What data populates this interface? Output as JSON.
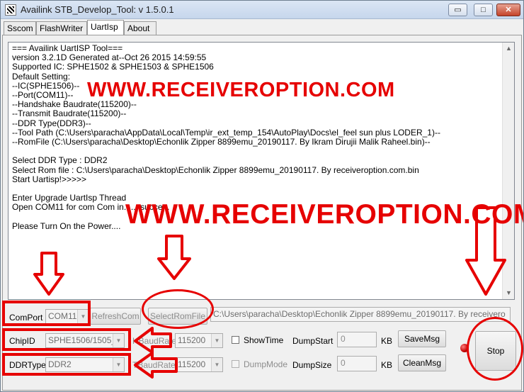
{
  "window": {
    "title": "Availink STB_Develop_Tool: v 1.5.0.1",
    "min_glyph": "▭",
    "max_glyph": "□",
    "close_glyph": "✕"
  },
  "tabs": [
    {
      "label": "Sscom"
    },
    {
      "label": "FlashWriter"
    },
    {
      "label": "UartIsp"
    },
    {
      "label": "About"
    }
  ],
  "log_lines": [
    "=== Availink UartISP Tool===",
    "version 3.2.1D Generated at--Oct 26 2015 14:59:55",
    "Supported IC: SPHE1502 & SPHE1503 & SPHE1506",
    "Default Setting:",
    "--IC(SPHE1506)--",
    "--Port(COM11)--",
    "--Handshake Baudrate(115200)--",
    "--Transmit Baudrate(115200)--",
    "--DDR Type(DDR3)--",
    "--Tool Path (C:\\Users\\paracha\\AppData\\Local\\Temp\\ir_ext_temp_154\\AutoPlay\\Docs\\el_feel sun plus LODER_1)--",
    "--RomFile (C:\\Users\\paracha\\Desktop\\Echonlik Zipper 8899emu_20190117. By Ikram Dirujii Malik Raheel.bin)--",
    "",
    "Select DDR Type : DDR2",
    "Select Rom file : C:\\Users\\paracha\\Desktop\\Echonlik Zipper 8899emu_20190117. By receiveroption.com.bin",
    "Start Uartisp!>>>>>",
    "",
    "Enter Upgrade UartIsp Thread",
    "Open COM11 for com Com in...... succe...",
    "",
    "Please Turn On the Power...."
  ],
  "controls": {
    "comport_label": "ComPort",
    "comport_value": "COM11",
    "refreshcom_label": "RefreshCom",
    "selectromfile_label": "SelectRomFile",
    "rom_path": "C:\\Users\\paracha\\Desktop\\Echonlik Zipper 8899emu_20190117. By receivero",
    "chipid_label": "ChipID",
    "chipid_value": "SPHE1506/1505_1",
    "hbaudrate_label": "HBaudRate",
    "hbaudrate_value": "115200",
    "showtime_label": "ShowTime",
    "dumpstart_label": "DumpStart",
    "dumpstart_value": "0",
    "dumpstart_unit": "KB",
    "savemsg_label": "SaveMsg",
    "ddrtype_label": "DDRType",
    "ddrtype_value": "DDR2",
    "tbaudrate_label": "TBaudRate",
    "tbaudrate_value": "115200",
    "dumpmode_label": "DumpMode",
    "dumpsize_label": "DumpSize",
    "dumpsize_value": "0",
    "dumpsize_unit": "KB",
    "cleanmsg_label": "CleanMsg",
    "stop_label": "Stop",
    "status_led_color": "#c00000"
  },
  "overlay": {
    "watermark": "WWW.RECEIVEROPTION.COM",
    "annotation_color": "#e60000"
  }
}
